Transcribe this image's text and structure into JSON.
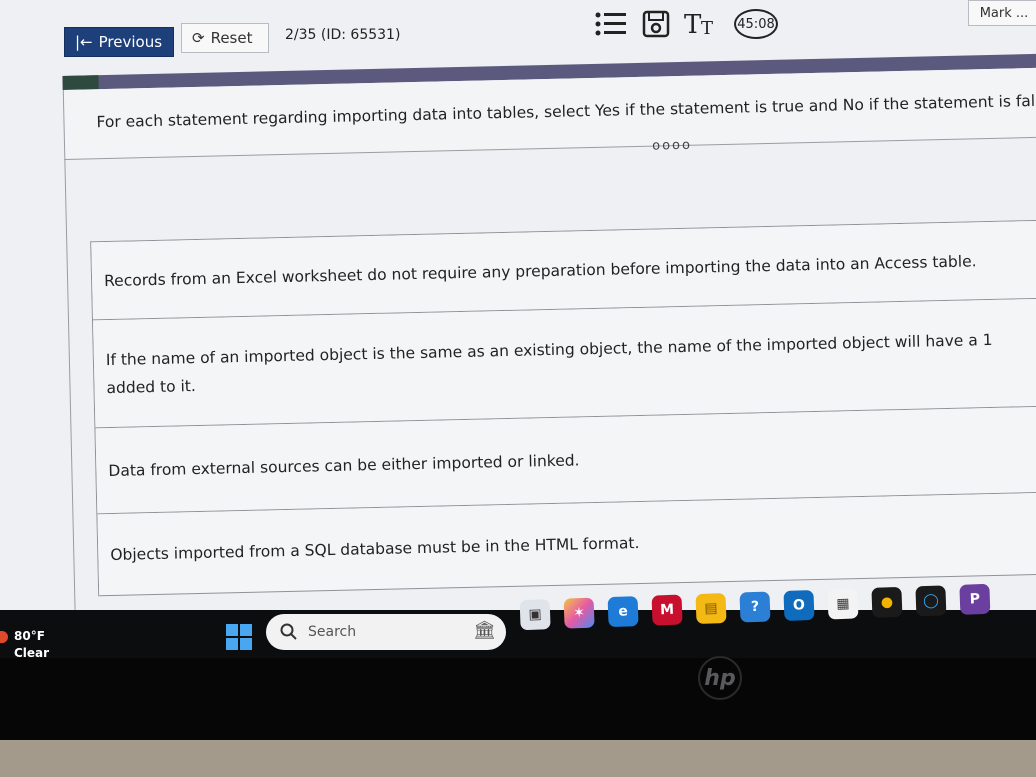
{
  "toolbar": {
    "previous_label": "Previous",
    "reset_label": "Reset",
    "question_id": "2/35 (ID: 65531)",
    "timer": "45:08",
    "mark_label": "Mark ..."
  },
  "question": {
    "instruction": "For each statement regarding importing data into tables, select Yes if the statement is true and No if the statement is fals",
    "dots": "oooo",
    "statements": [
      "Records from an Excel worksheet do not require any preparation before importing the data into an Access table.",
      "If the name of an imported object is the same as an existing object, the name of the imported object will have a 1 added to it.",
      "Data from external sources can be either imported or linked.",
      "Objects imported from a SQL database must be in the HTML format."
    ]
  },
  "taskbar": {
    "temperature": "80°F",
    "condition": "Clear",
    "search_placeholder": "Search"
  },
  "colors": {
    "primary_button": "#1d3f7a",
    "header_bar": "#5b5a7e"
  }
}
